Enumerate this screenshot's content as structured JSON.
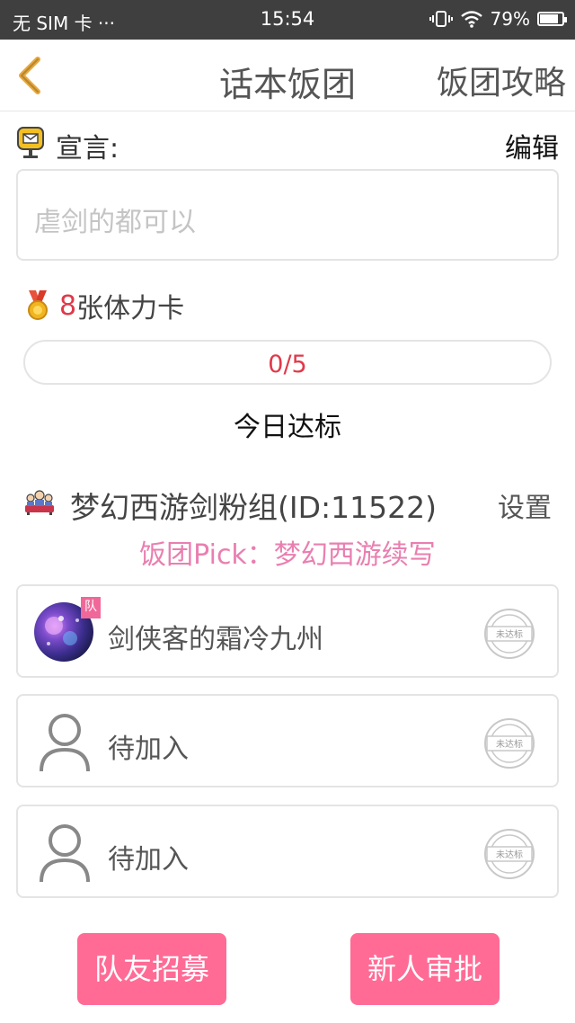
{
  "status_bar": {
    "carrier": "无 SIM 卡 ···",
    "time": "15:54",
    "battery": "79%"
  },
  "nav": {
    "title": "话本饭团",
    "right_label": "饭团攻略"
  },
  "declaration": {
    "label": "宣言:",
    "edit_label": "编辑",
    "text": "虐剑的都可以"
  },
  "stamina": {
    "count": "8",
    "label": "张体力卡"
  },
  "progress": {
    "text": "0/5",
    "fraction": 0.0,
    "today_label": "今日达标"
  },
  "group": {
    "name": "梦幻西游剑粉组(ID:11522)",
    "settings_label": "设置",
    "pick": "饭团Pick：梦幻西游续写"
  },
  "members": [
    {
      "name": "剑侠客的霜冷九州",
      "badge": "队",
      "stamp": "未达标"
    },
    {
      "name": "待加入",
      "stamp": "未达标"
    },
    {
      "name": "待加入",
      "stamp": "未达标"
    }
  ],
  "buttons": {
    "recruit": "队友招募",
    "approve": "新人审批"
  },
  "colors": {
    "accent_pink": "#ff6b95",
    "red_text": "#e0394a",
    "pick_pink": "#e97fb0"
  }
}
